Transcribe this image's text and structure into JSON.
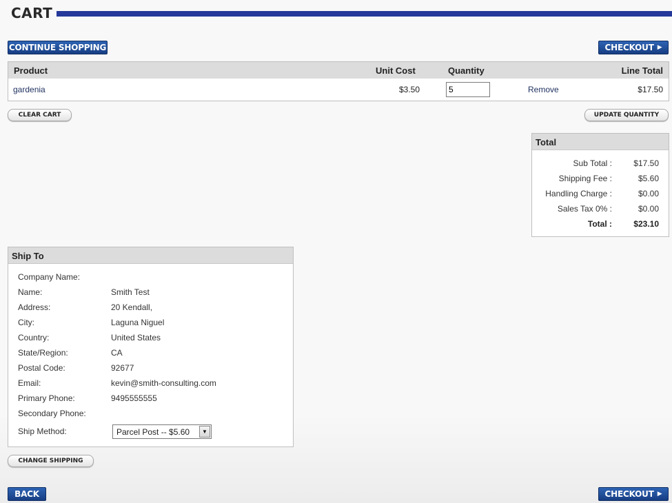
{
  "header": {
    "title": "CART"
  },
  "buttons": {
    "continue_shopping": "CONTINUE SHOPPING",
    "checkout": "CHECKOUT",
    "clear_cart": "CLEAR CART",
    "update_quantity": "UPDATE QUANTITY",
    "change_shipping": "CHANGE SHIPPING",
    "back": "BACK"
  },
  "cart": {
    "columns": {
      "product": "Product",
      "unit_cost": "Unit Cost",
      "quantity": "Quantity",
      "line_total": "Line Total"
    },
    "items": [
      {
        "product": "gardenia",
        "unit_cost": "$3.50",
        "quantity": "5",
        "remove": "Remove",
        "line_total": "$17.50"
      }
    ]
  },
  "total": {
    "heading": "Total",
    "rows": [
      {
        "label": "Sub Total :",
        "value": "$17.50"
      },
      {
        "label": "Shipping Fee :",
        "value": "$5.60"
      },
      {
        "label": "Handling Charge :",
        "value": "$0.00"
      },
      {
        "label": "Sales Tax 0% :",
        "value": "$0.00"
      },
      {
        "label": "Total :",
        "value": "$23.10"
      }
    ]
  },
  "ship_to": {
    "heading": "Ship To",
    "fields": [
      {
        "label": "Company Name:",
        "value": ""
      },
      {
        "label": "Name:",
        "value": "Smith Test"
      },
      {
        "label": "Address:",
        "value": "20 Kendall,"
      },
      {
        "label": "City:",
        "value": "Laguna Niguel"
      },
      {
        "label": "Country:",
        "value": "United States"
      },
      {
        "label": "State/Region:",
        "value": "CA"
      },
      {
        "label": "Postal Code:",
        "value": "92677"
      },
      {
        "label": "Email:",
        "value": "kevin@smith-consulting.com"
      },
      {
        "label": "Primary Phone:",
        "value": "9495555555"
      },
      {
        "label": "Secondary Phone:",
        "value": ""
      }
    ],
    "ship_method_label": "Ship Method:",
    "ship_method_selected": "Parcel Post -- $5.60"
  },
  "icons": {
    "checkout_arrow": "play-triangle-icon",
    "select_arrow": "caret-down-icon"
  },
  "colors": {
    "accent": "#24399a",
    "button_blue": "#1f4a96",
    "panel_header": "#dcdcdc"
  }
}
